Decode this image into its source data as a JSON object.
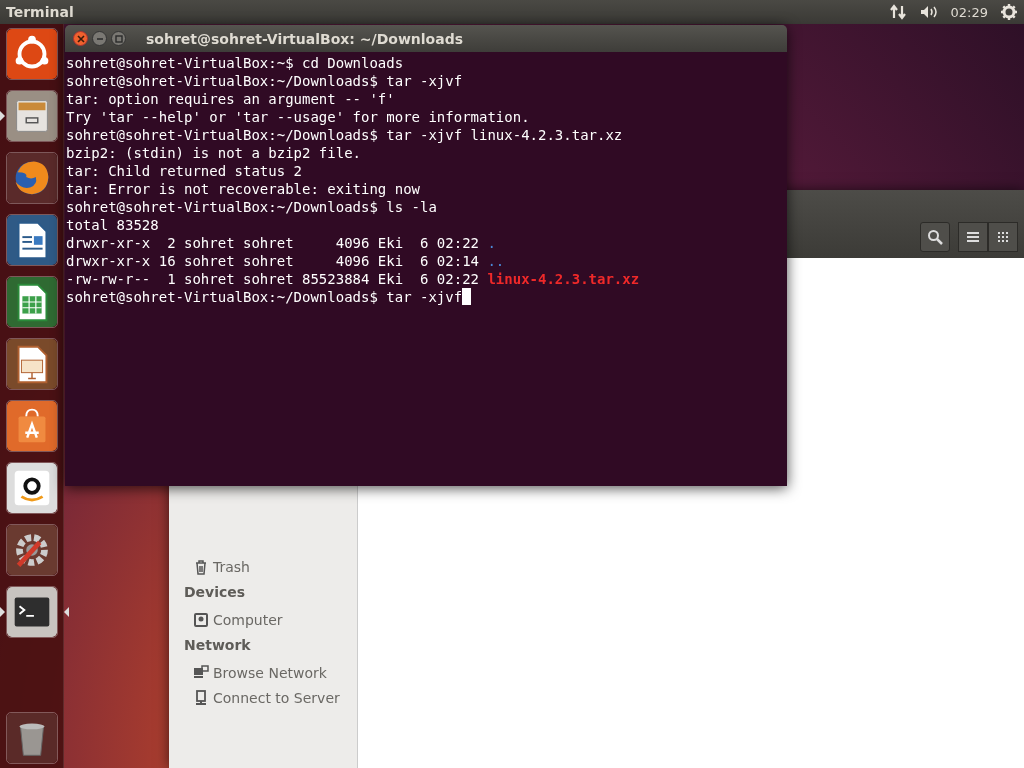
{
  "top_panel": {
    "app_title": "Terminal",
    "clock": "02:29"
  },
  "launcher": {
    "items": [
      {
        "kind": "ubuntu",
        "running": false,
        "focused": false
      },
      {
        "kind": "files",
        "running": true,
        "focused": false
      },
      {
        "kind": "browser",
        "running": false,
        "focused": false
      },
      {
        "kind": "writer",
        "running": false,
        "focused": false
      },
      {
        "kind": "calc",
        "running": false,
        "focused": false
      },
      {
        "kind": "impress",
        "running": false,
        "focused": false
      },
      {
        "kind": "store",
        "running": false,
        "focused": false
      },
      {
        "kind": "shop",
        "running": false,
        "focused": false
      },
      {
        "kind": "settings",
        "running": false,
        "focused": false
      },
      {
        "kind": "terminal",
        "running": true,
        "focused": true
      }
    ],
    "trash": {
      "kind": "trash"
    }
  },
  "files_window": {
    "sidebar": [
      {
        "kind": "trash",
        "label": "Trash"
      },
      {
        "kind": "heading",
        "label": "Devices"
      },
      {
        "kind": "computer",
        "label": "Computer"
      },
      {
        "kind": "heading",
        "label": "Network"
      },
      {
        "kind": "network",
        "label": "Browse Network"
      },
      {
        "kind": "server",
        "label": "Connect to Server"
      }
    ]
  },
  "terminal": {
    "title": "sohret@sohret-VirtualBox: ~/Downloads",
    "lines": [
      {
        "segments": [
          {
            "kind": "text",
            "text": "sohret@sohret-VirtualBox:~$ cd Downloads"
          }
        ],
        "cursor": false
      },
      {
        "segments": [
          {
            "kind": "text",
            "text": "sohret@sohret-VirtualBox:~/Downloads$ tar -xjvf"
          }
        ],
        "cursor": false
      },
      {
        "segments": [
          {
            "kind": "text",
            "text": "tar: option requires an argument -- 'f'"
          }
        ],
        "cursor": false
      },
      {
        "segments": [
          {
            "kind": "text",
            "text": "Try 'tar --help' or 'tar --usage' for more information."
          }
        ],
        "cursor": false
      },
      {
        "segments": [
          {
            "kind": "text",
            "text": "sohret@sohret-VirtualBox:~/Downloads$ tar -xjvf linux-4.2.3.tar.xz"
          }
        ],
        "cursor": false
      },
      {
        "segments": [
          {
            "kind": "text",
            "text": "bzip2: (stdin) is not a bzip2 file."
          }
        ],
        "cursor": false
      },
      {
        "segments": [
          {
            "kind": "text",
            "text": "tar: Child returned status 2"
          }
        ],
        "cursor": false
      },
      {
        "segments": [
          {
            "kind": "text",
            "text": "tar: Error is not recoverable: exiting now"
          }
        ],
        "cursor": false
      },
      {
        "segments": [
          {
            "kind": "text",
            "text": "sohret@sohret-VirtualBox:~/Downloads$ ls -la"
          }
        ],
        "cursor": false
      },
      {
        "segments": [
          {
            "kind": "text",
            "text": "total 83528"
          }
        ],
        "cursor": false
      },
      {
        "segments": [
          {
            "kind": "text",
            "text": "drwxr-xr-x  2 sohret sohret     4096 Eki  6 02:22"
          },
          {
            "kind": "dir",
            "text": "."
          }
        ],
        "cursor": false
      },
      {
        "segments": [
          {
            "kind": "text",
            "text": "drwxr-xr-x 16 sohret sohret     4096 Eki  6 02:14"
          },
          {
            "kind": "dir",
            "text": ".."
          }
        ],
        "cursor": false
      },
      {
        "segments": [
          {
            "kind": "text",
            "text": "-rw-rw-r--  1 sohret sohret 85523884 Eki  6 02:22"
          },
          {
            "kind": "archive",
            "text": "linux-4.2.3.tar.xz"
          }
        ],
        "cursor": false
      },
      {
        "segments": [
          {
            "kind": "text",
            "text": "sohret@sohret-VirtualBox:~/Downloads$ tar -xjvf"
          }
        ],
        "cursor": true
      }
    ]
  }
}
